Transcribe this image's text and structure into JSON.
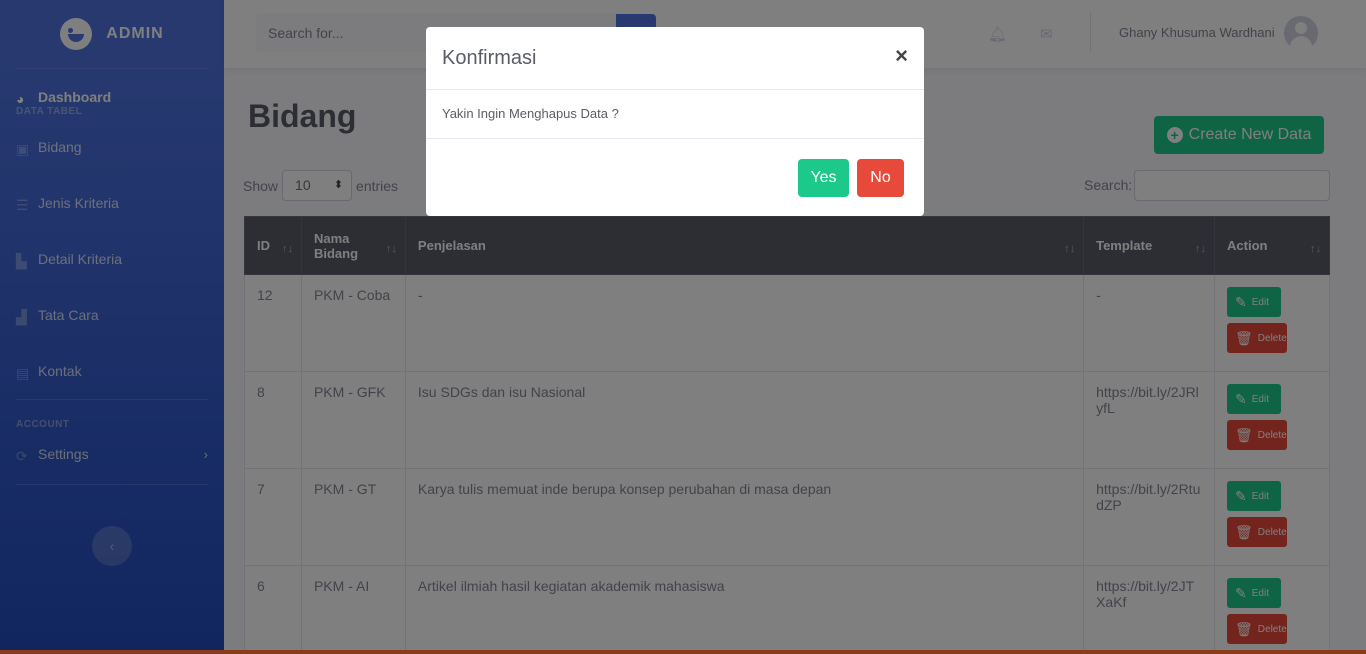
{
  "sidebar": {
    "brand": "ADMIN",
    "items": [
      {
        "label": "Dashboard",
        "icon": "tachometer-icon"
      },
      {
        "label": "Bidang",
        "icon": "cube-icon"
      },
      {
        "label": "Jenis Kriteria",
        "icon": "list-icon"
      },
      {
        "label": "Detail Kriteria",
        "icon": "chart-icon"
      },
      {
        "label": "Tata Cara",
        "icon": "users-icon"
      },
      {
        "label": "Kontak",
        "icon": "address-card-icon"
      },
      {
        "label": "Settings",
        "icon": "cogs-icon"
      }
    ],
    "headings": {
      "data": "DATA TABEL",
      "account": "ACCOUNT"
    }
  },
  "topbar": {
    "search_placeholder": "Search for...",
    "user_name": "Ghany Khusuma Wardhani"
  },
  "main": {
    "title": "Bidang",
    "create_label": "Create New Data",
    "show_label": "Show",
    "entries_value": "10",
    "entries_label": "entries",
    "search_label": "Search:"
  },
  "table": {
    "headers": [
      "ID",
      "Nama Bidang",
      "Penjelasan",
      "Template",
      "Action"
    ],
    "rows": [
      {
        "id": "12",
        "nama": "PKM - Coba",
        "penjelasan": "-",
        "template": "-"
      },
      {
        "id": "8",
        "nama": "PKM - GFK",
        "penjelasan": "Isu SDGs dan isu Nasional",
        "template": "https://bit.ly/2JRlyfL"
      },
      {
        "id": "7",
        "nama": "PKM - GT",
        "penjelasan": "Karya tulis memuat inde berupa konsep perubahan di masa depan",
        "template": "https://bit.ly/2RtudZP"
      },
      {
        "id": "6",
        "nama": "PKM - AI",
        "penjelasan": "Artikel ilmiah hasil kegiatan akademik mahasiswa",
        "template": "https://bit.ly/2JTXaKf"
      }
    ],
    "edit_label": "Edit",
    "delete_label": "Delete"
  },
  "modal": {
    "title": "Konfirmasi",
    "close": "×",
    "message": "Yakin Ingin Menghapus Data ?",
    "yes_label": "Yes",
    "no_label": "No"
  },
  "colors": {
    "primary": "#4e73df",
    "success": "#1cc88a",
    "danger": "#e74a3b"
  }
}
